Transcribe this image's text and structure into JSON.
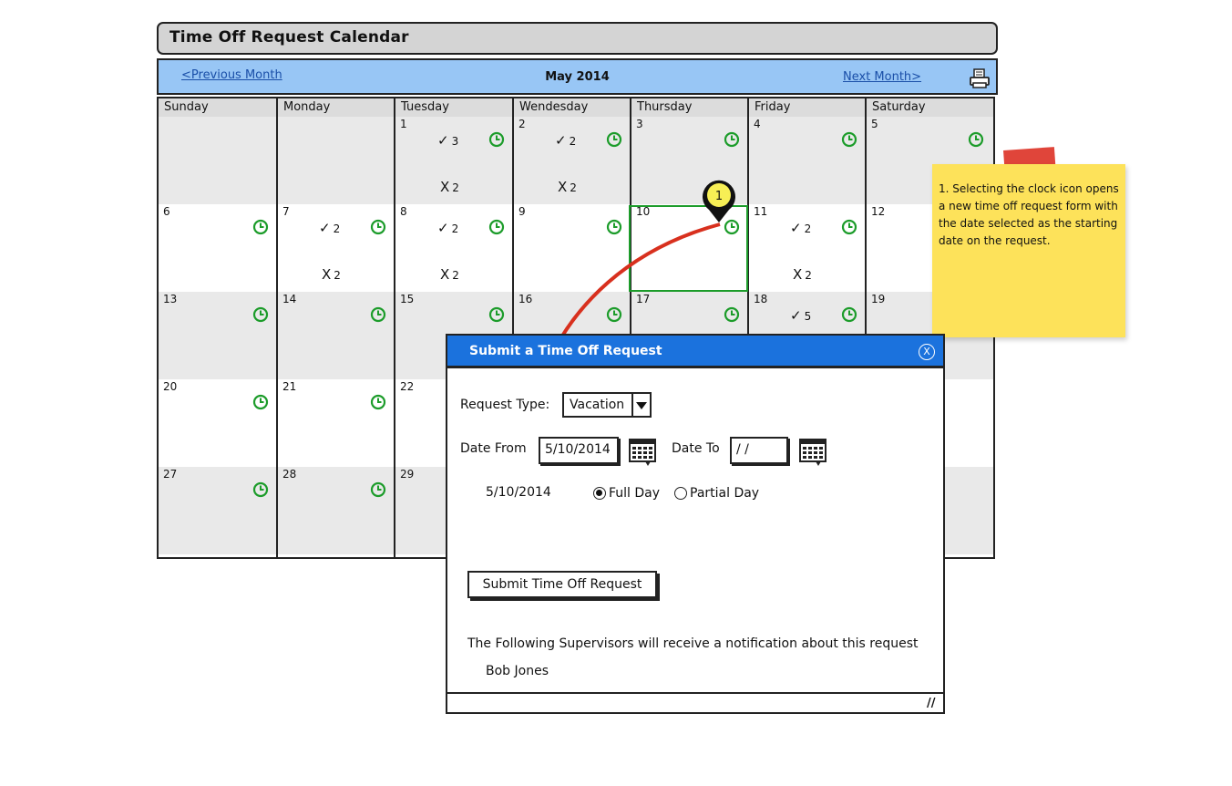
{
  "window": {
    "title": "Time Off Request Calendar"
  },
  "nav": {
    "prev_label": "<Previous Month",
    "month_label": "May 2014",
    "next_label": "Next Month>",
    "print_icon": "printer-icon"
  },
  "calendar": {
    "days": [
      "Sunday",
      "Monday",
      "Tuesday",
      "Wendesday",
      "Thursday",
      "Friday",
      "Saturday"
    ],
    "weeks": [
      [
        {
          "date": "",
          "clock": false
        },
        {
          "date": "",
          "clock": false
        },
        {
          "date": "1",
          "clock": true,
          "approved": "3",
          "denied": "2"
        },
        {
          "date": "2",
          "clock": true,
          "approved": "2",
          "denied": "2"
        },
        {
          "date": "3",
          "clock": true
        },
        {
          "date": "4",
          "clock": true
        },
        {
          "date": "5",
          "clock": true
        }
      ],
      [
        {
          "date": "6",
          "clock": true
        },
        {
          "date": "7",
          "clock": true,
          "approved": "2",
          "denied": "2"
        },
        {
          "date": "8",
          "clock": true,
          "approved": "2",
          "denied": "2"
        },
        {
          "date": "9",
          "clock": true
        },
        {
          "date": "10",
          "clock": true,
          "selected": true
        },
        {
          "date": "11",
          "clock": true,
          "approved": "2",
          "denied": "2"
        },
        {
          "date": "12",
          "clock": false
        }
      ],
      [
        {
          "date": "13",
          "clock": true
        },
        {
          "date": "14",
          "clock": true
        },
        {
          "date": "15",
          "clock": true
        },
        {
          "date": "16",
          "clock": true
        },
        {
          "date": "17",
          "clock": true
        },
        {
          "date": "18",
          "clock": true,
          "approved": "5"
        },
        {
          "date": "19",
          "clock": false
        }
      ],
      [
        {
          "date": "20",
          "clock": true
        },
        {
          "date": "21",
          "clock": true
        },
        {
          "date": "22",
          "clock": false
        },
        {
          "date": "",
          "clock": false
        },
        {
          "date": "",
          "clock": false
        },
        {
          "date": "",
          "clock": false
        },
        {
          "date": "",
          "clock": false
        }
      ],
      [
        {
          "date": "27",
          "clock": true
        },
        {
          "date": "28",
          "clock": true
        },
        {
          "date": "29",
          "clock": false
        },
        {
          "date": "",
          "clock": false
        },
        {
          "date": "",
          "clock": false
        },
        {
          "date": "",
          "clock": false
        },
        {
          "date": "",
          "clock": false
        }
      ]
    ],
    "approved_symbol": "✓",
    "denied_symbol": "X",
    "clock_color": "#1c9c2a"
  },
  "annotation": {
    "marker_number": "1",
    "note_text": "1. Selecting the clock icon opens a new time off request form with the date selected as the starting date on the request.",
    "arrow_color": "#d8301e",
    "note_color": "#fde25a"
  },
  "dialog": {
    "title": "Submit a Time Off Request",
    "close_label": "X",
    "request_type_label": "Request Type:",
    "request_type_value": "Vacation",
    "date_from_label": "Date From",
    "date_from_value": "5/10/2014",
    "date_to_label": "Date To",
    "date_to_value": " /  /",
    "row_date": "5/10/2014",
    "full_day_label": "Full Day",
    "partial_day_label": "Partial Day",
    "full_day_checked": true,
    "submit_label": "Submit Time Off Request",
    "supervisors_text": "The Following Supervisors will receive a notification about this request",
    "supervisor_name": "Bob Jones"
  }
}
